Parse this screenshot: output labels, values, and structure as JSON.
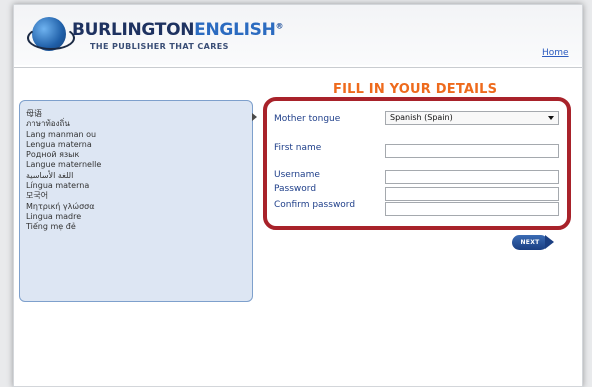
{
  "header": {
    "brand_bold": "BURLINGTON",
    "brand_light": "ENGLISH",
    "brand_mark": "®",
    "tagline": "THE PUBLISHER THAT CARES",
    "home_link": "Home"
  },
  "form": {
    "heading": "FILL IN YOUR DETAILS",
    "mother_tongue_label": "Mother tongue",
    "mother_tongue_value": "Spanish (Spain)",
    "first_name_label": "First name",
    "first_name_value": "",
    "username_label": "Username",
    "username_value": "",
    "password_label": "Password",
    "password_value": "",
    "confirm_password_label": "Confirm password",
    "confirm_password_value": "",
    "next_label": "NEXT"
  },
  "languages": [
    "母语",
    "ภาษาท้องถิ่น",
    "Lang manman ou",
    "Lengua materna",
    "Родной язык",
    "Langue maternelle",
    "اللغة الأساسية",
    "Língua materna",
    "모국어",
    "Μητρική γλώσσα",
    "Lingua madre",
    "Tiếng mẹ đẻ"
  ],
  "colors": {
    "heading": "#ee6a1c",
    "highlight_border": "#a8222a",
    "label": "#1f3f8a",
    "panel_bg": "#dde6f3"
  }
}
